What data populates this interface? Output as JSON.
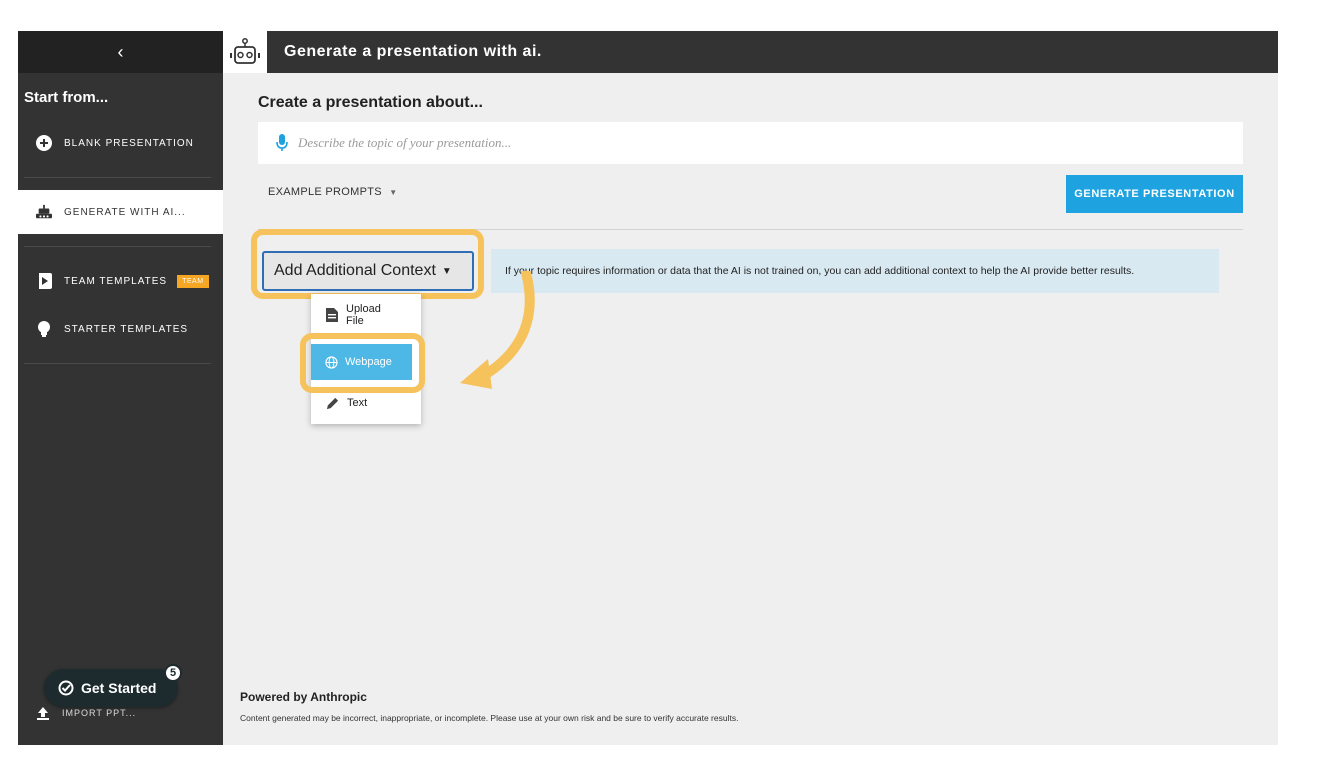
{
  "sidebar": {
    "back_icon": "chevron-left-icon",
    "back_glyph": "‹",
    "heading": "Start from...",
    "items": [
      {
        "label": "BLANK PRESENTATION",
        "icon": "plus-circle-icon"
      },
      {
        "label": "GENERATE WITH AI...",
        "icon": "robot-icon"
      },
      {
        "label": "TEAM TEMPLATES",
        "icon": "play-template-icon",
        "badge": "TEAM"
      },
      {
        "label": "STARTER TEMPLATES",
        "icon": "lightbulb-icon"
      }
    ],
    "import_label": "IMPORT PPT..."
  },
  "header": {
    "title": "Generate a presentation with ai.",
    "logo_icon": "robot-icon"
  },
  "main": {
    "title": "Create a presentation about...",
    "prompt_placeholder": "Describe the topic of your presentation...",
    "example_prompts_label": "EXAMPLE PROMPTS",
    "generate_button": "GENERATE PRESENTATION",
    "context_button": "Add Additional Context",
    "context_info": "If your topic requires information or data that the AI is not trained on, you can add additional context to help the AI provide better results.",
    "context_menu": [
      {
        "label": "Upload File",
        "icon": "document-icon"
      },
      {
        "label": "Webpage",
        "icon": "globe-icon"
      },
      {
        "label": "Text",
        "icon": "pencil-icon"
      }
    ]
  },
  "footer": {
    "powered_by": "Powered by Anthropic",
    "disclaimer": "Content generated may be incorrect, inappropriate, or incomplete. Please use at your own risk and be sure to verify accurate results."
  },
  "get_started": {
    "label": "Get Started",
    "badge_count": "5"
  },
  "colors": {
    "accent_blue": "#1fa3e0",
    "highlight_orange": "#f6c25b",
    "sidebar_dark": "#333333",
    "team_badge": "#f5a623"
  }
}
